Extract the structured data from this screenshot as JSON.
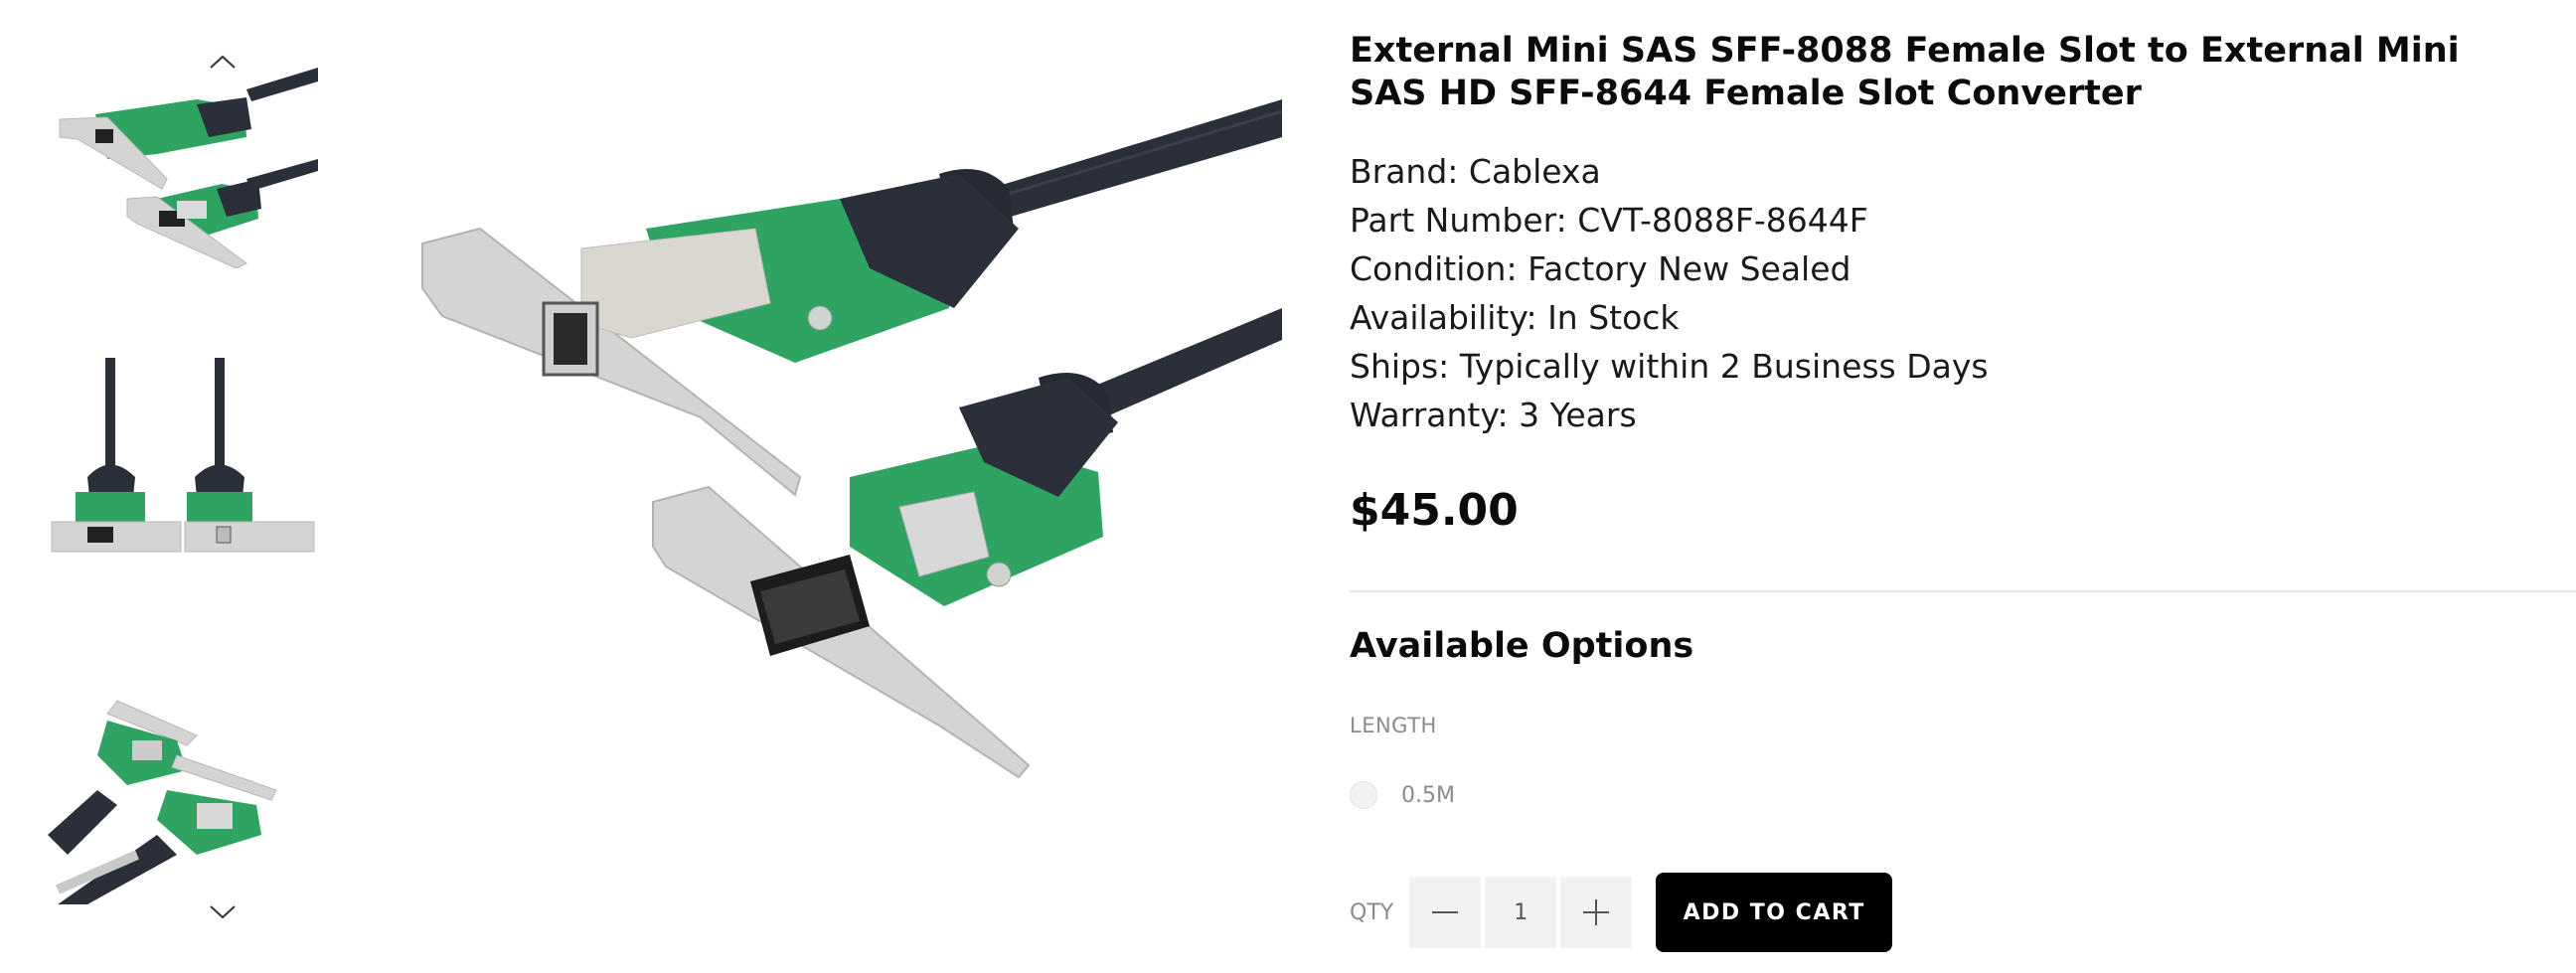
{
  "gallery": {
    "up_icon": "chevron-up-icon",
    "down_icon": "chevron-down-icon",
    "thumbnails": [
      {
        "name": "thumbnail-angled-pair"
      },
      {
        "name": "thumbnail-front-pair"
      },
      {
        "name": "thumbnail-rear-pair"
      }
    ]
  },
  "product": {
    "title": "External Mini SAS SFF-8088 Female Slot to External Mini SAS HD SFF-8644 Female Slot Converter",
    "specs": {
      "brand": "Brand: Cablexa",
      "part_number": "Part Number: CVT-8088F-8644F",
      "condition": "Condition: Factory New Sealed",
      "availability": "Availability: In Stock",
      "ships": "Ships: Typically within 2 Business Days",
      "warranty": "Warranty: 3 Years"
    },
    "price": "$45.00"
  },
  "options": {
    "heading": "Available Options",
    "length_label": "LENGTH",
    "length_choices": [
      "0.5M"
    ]
  },
  "purchase": {
    "qty_label": "QTY",
    "qty_value": "1",
    "add_to_cart": "ADD TO CART",
    "minus_icon": "minus-icon",
    "plus_icon": "plus-icon"
  },
  "colors": {
    "pcb_green": "#2fa462",
    "bracket_silver": "#d4d4d2",
    "cable_dark": "#2b2f3a",
    "button_black": "#000000"
  }
}
